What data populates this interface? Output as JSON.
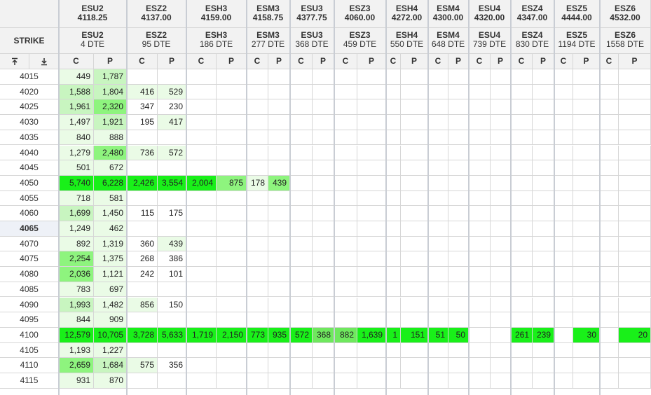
{
  "header": {
    "strike_label": "STRIKE",
    "call_label": "C",
    "put_label": "P",
    "sort_top_icon": "pin-top-icon",
    "sort_bottom_icon": "pin-bottom-icon"
  },
  "expirations": [
    {
      "future": "ESU2",
      "price": "4118.25",
      "dte_future": "ESU2",
      "dte": "4 DTE"
    },
    {
      "future": "ESZ2",
      "price": "4137.00",
      "dte_future": "ESZ2",
      "dte": "95 DTE"
    },
    {
      "future": "ESH3",
      "price": "4159.00",
      "dte_future": "ESH3",
      "dte": "186 DTE"
    },
    {
      "future": "ESM3",
      "price": "4158.75",
      "dte_future": "ESM3",
      "dte": "277 DTE"
    },
    {
      "future": "ESU3",
      "price": "4377.75",
      "dte_future": "ESU3",
      "dte": "368 DTE"
    },
    {
      "future": "ESZ3",
      "price": "4060.00",
      "dte_future": "ESZ3",
      "dte": "459 DTE"
    },
    {
      "future": "ESH4",
      "price": "4272.00",
      "dte_future": "ESH4",
      "dte": "550 DTE"
    },
    {
      "future": "ESM4",
      "price": "4300.00",
      "dte_future": "ESM4",
      "dte": "648 DTE"
    },
    {
      "future": "ESU4",
      "price": "4320.00",
      "dte_future": "ESU4",
      "dte": "739 DTE"
    },
    {
      "future": "ESZ4",
      "price": "4347.00",
      "dte_future": "ESZ4",
      "dte": "830 DTE"
    },
    {
      "future": "ESZ5",
      "price": "4444.00",
      "dte_future": "ESZ5",
      "dte": "1194 DTE"
    },
    {
      "future": "ESZ6",
      "price": "4532.00",
      "dte_future": "ESZ6",
      "dte": "1558 DTE"
    }
  ],
  "selected_strike": "4065",
  "rows": [
    {
      "strike": "4015",
      "cells": [
        [
          "449",
          "1,787"
        ],
        [
          "",
          ""
        ],
        [
          "",
          ""
        ],
        [
          "",
          ""
        ],
        [
          "",
          ""
        ],
        [
          "",
          ""
        ],
        [
          "",
          ""
        ],
        [
          "",
          ""
        ],
        [
          "",
          ""
        ],
        [
          "",
          ""
        ],
        [
          "",
          ""
        ],
        [
          "",
          ""
        ]
      ]
    },
    {
      "strike": "4020",
      "cells": [
        [
          "1,588",
          "1,804"
        ],
        [
          "416",
          "529"
        ],
        [
          "",
          ""
        ],
        [
          "",
          ""
        ],
        [
          "",
          ""
        ],
        [
          "",
          ""
        ],
        [
          "",
          ""
        ],
        [
          "",
          ""
        ],
        [
          "",
          ""
        ],
        [
          "",
          ""
        ],
        [
          "",
          ""
        ],
        [
          "",
          ""
        ]
      ]
    },
    {
      "strike": "4025",
      "cells": [
        [
          "1,961",
          "2,320"
        ],
        [
          "347",
          "230"
        ],
        [
          "",
          ""
        ],
        [
          "",
          ""
        ],
        [
          "",
          ""
        ],
        [
          "",
          ""
        ],
        [
          "",
          ""
        ],
        [
          "",
          ""
        ],
        [
          "",
          ""
        ],
        [
          "",
          ""
        ],
        [
          "",
          ""
        ],
        [
          "",
          ""
        ]
      ]
    },
    {
      "strike": "4030",
      "cells": [
        [
          "1,497",
          "1,921"
        ],
        [
          "195",
          "417"
        ],
        [
          "",
          ""
        ],
        [
          "",
          ""
        ],
        [
          "",
          ""
        ],
        [
          "",
          ""
        ],
        [
          "",
          ""
        ],
        [
          "",
          ""
        ],
        [
          "",
          ""
        ],
        [
          "",
          ""
        ],
        [
          "",
          ""
        ],
        [
          "",
          ""
        ]
      ]
    },
    {
      "strike": "4035",
      "cells": [
        [
          "840",
          "888"
        ],
        [
          "",
          ""
        ],
        [
          "",
          ""
        ],
        [
          "",
          ""
        ],
        [
          "",
          ""
        ],
        [
          "",
          ""
        ],
        [
          "",
          ""
        ],
        [
          "",
          ""
        ],
        [
          "",
          ""
        ],
        [
          "",
          ""
        ],
        [
          "",
          ""
        ],
        [
          "",
          ""
        ]
      ]
    },
    {
      "strike": "4040",
      "cells": [
        [
          "1,279",
          "2,480"
        ],
        [
          "736",
          "572"
        ],
        [
          "",
          ""
        ],
        [
          "",
          ""
        ],
        [
          "",
          ""
        ],
        [
          "",
          ""
        ],
        [
          "",
          ""
        ],
        [
          "",
          ""
        ],
        [
          "",
          ""
        ],
        [
          "",
          ""
        ],
        [
          "",
          ""
        ],
        [
          "",
          ""
        ]
      ]
    },
    {
      "strike": "4045",
      "cells": [
        [
          "501",
          "672"
        ],
        [
          "",
          ""
        ],
        [
          "",
          ""
        ],
        [
          "",
          ""
        ],
        [
          "",
          ""
        ],
        [
          "",
          ""
        ],
        [
          "",
          ""
        ],
        [
          "",
          ""
        ],
        [
          "",
          ""
        ],
        [
          "",
          ""
        ],
        [
          "",
          ""
        ],
        [
          "",
          ""
        ]
      ]
    },
    {
      "strike": "4050",
      "cells": [
        [
          "5,740",
          "6,228"
        ],
        [
          "2,426",
          "3,554"
        ],
        [
          "2,004",
          "875"
        ],
        [
          "178",
          "439"
        ],
        [
          "",
          ""
        ],
        [
          "",
          ""
        ],
        [
          "",
          ""
        ],
        [
          "",
          ""
        ],
        [
          "",
          ""
        ],
        [
          "",
          ""
        ],
        [
          "",
          ""
        ],
        [
          "",
          ""
        ]
      ]
    },
    {
      "strike": "4055",
      "cells": [
        [
          "718",
          "581"
        ],
        [
          "",
          ""
        ],
        [
          "",
          ""
        ],
        [
          "",
          ""
        ],
        [
          "",
          ""
        ],
        [
          "",
          ""
        ],
        [
          "",
          ""
        ],
        [
          "",
          ""
        ],
        [
          "",
          ""
        ],
        [
          "",
          ""
        ],
        [
          "",
          ""
        ],
        [
          "",
          ""
        ]
      ]
    },
    {
      "strike": "4060",
      "cells": [
        [
          "1,699",
          "1,450"
        ],
        [
          "115",
          "175"
        ],
        [
          "",
          ""
        ],
        [
          "",
          ""
        ],
        [
          "",
          ""
        ],
        [
          "",
          ""
        ],
        [
          "",
          ""
        ],
        [
          "",
          ""
        ],
        [
          "",
          ""
        ],
        [
          "",
          ""
        ],
        [
          "",
          ""
        ],
        [
          "",
          ""
        ]
      ]
    },
    {
      "strike": "4065",
      "cells": [
        [
          "1,249",
          "462"
        ],
        [
          "",
          ""
        ],
        [
          "",
          ""
        ],
        [
          "",
          ""
        ],
        [
          "",
          ""
        ],
        [
          "",
          ""
        ],
        [
          "",
          ""
        ],
        [
          "",
          ""
        ],
        [
          "",
          ""
        ],
        [
          "",
          ""
        ],
        [
          "",
          ""
        ],
        [
          "",
          ""
        ]
      ]
    },
    {
      "strike": "4070",
      "cells": [
        [
          "892",
          "1,319"
        ],
        [
          "360",
          "439"
        ],
        [
          "",
          ""
        ],
        [
          "",
          ""
        ],
        [
          "",
          ""
        ],
        [
          "",
          ""
        ],
        [
          "",
          ""
        ],
        [
          "",
          ""
        ],
        [
          "",
          ""
        ],
        [
          "",
          ""
        ],
        [
          "",
          ""
        ],
        [
          "",
          ""
        ]
      ]
    },
    {
      "strike": "4075",
      "cells": [
        [
          "2,254",
          "1,375"
        ],
        [
          "268",
          "386"
        ],
        [
          "",
          ""
        ],
        [
          "",
          ""
        ],
        [
          "",
          ""
        ],
        [
          "",
          ""
        ],
        [
          "",
          ""
        ],
        [
          "",
          ""
        ],
        [
          "",
          ""
        ],
        [
          "",
          ""
        ],
        [
          "",
          ""
        ],
        [
          "",
          ""
        ]
      ]
    },
    {
      "strike": "4080",
      "cells": [
        [
          "2,036",
          "1,121"
        ],
        [
          "242",
          "101"
        ],
        [
          "",
          ""
        ],
        [
          "",
          ""
        ],
        [
          "",
          ""
        ],
        [
          "",
          ""
        ],
        [
          "",
          ""
        ],
        [
          "",
          ""
        ],
        [
          "",
          ""
        ],
        [
          "",
          ""
        ],
        [
          "",
          ""
        ],
        [
          "",
          ""
        ]
      ]
    },
    {
      "strike": "4085",
      "cells": [
        [
          "783",
          "697"
        ],
        [
          "",
          ""
        ],
        [
          "",
          ""
        ],
        [
          "",
          ""
        ],
        [
          "",
          ""
        ],
        [
          "",
          ""
        ],
        [
          "",
          ""
        ],
        [
          "",
          ""
        ],
        [
          "",
          ""
        ],
        [
          "",
          ""
        ],
        [
          "",
          ""
        ],
        [
          "",
          ""
        ]
      ]
    },
    {
      "strike": "4090",
      "cells": [
        [
          "1,993",
          "1,482"
        ],
        [
          "856",
          "150"
        ],
        [
          "",
          ""
        ],
        [
          "",
          ""
        ],
        [
          "",
          ""
        ],
        [
          "",
          ""
        ],
        [
          "",
          ""
        ],
        [
          "",
          ""
        ],
        [
          "",
          ""
        ],
        [
          "",
          ""
        ],
        [
          "",
          ""
        ],
        [
          "",
          ""
        ]
      ]
    },
    {
      "strike": "4095",
      "cells": [
        [
          "844",
          "909"
        ],
        [
          "",
          ""
        ],
        [
          "",
          ""
        ],
        [
          "",
          ""
        ],
        [
          "",
          ""
        ],
        [
          "",
          ""
        ],
        [
          "",
          ""
        ],
        [
          "",
          ""
        ],
        [
          "",
          ""
        ],
        [
          "",
          ""
        ],
        [
          "",
          ""
        ],
        [
          "",
          ""
        ]
      ]
    },
    {
      "strike": "4100",
      "cells": [
        [
          "12,579",
          "10,705"
        ],
        [
          "3,728",
          "5,633"
        ],
        [
          "1,719",
          "2,150"
        ],
        [
          "773",
          "935"
        ],
        [
          "572",
          "368"
        ],
        [
          "882",
          "1,639"
        ],
        [
          "1",
          "151"
        ],
        [
          "51",
          "50"
        ],
        [
          "",
          ""
        ],
        [
          "261",
          "239"
        ],
        [
          "",
          "30"
        ],
        [
          "",
          "20"
        ]
      ]
    },
    {
      "strike": "4105",
      "cells": [
        [
          "1,193",
          "1,227"
        ],
        [
          "",
          ""
        ],
        [
          "",
          ""
        ],
        [
          "",
          ""
        ],
        [
          "",
          ""
        ],
        [
          "",
          ""
        ],
        [
          "",
          ""
        ],
        [
          "",
          ""
        ],
        [
          "",
          ""
        ],
        [
          "",
          ""
        ],
        [
          "",
          ""
        ],
        [
          "",
          ""
        ]
      ]
    },
    {
      "strike": "4110",
      "cells": [
        [
          "2,659",
          "1,684"
        ],
        [
          "575",
          "356"
        ],
        [
          "",
          ""
        ],
        [
          "",
          ""
        ],
        [
          "",
          ""
        ],
        [
          "",
          ""
        ],
        [
          "",
          ""
        ],
        [
          "",
          ""
        ],
        [
          "",
          ""
        ],
        [
          "",
          ""
        ],
        [
          "",
          ""
        ],
        [
          "",
          ""
        ]
      ]
    },
    {
      "strike": "4115",
      "cells": [
        [
          "931",
          "870"
        ],
        [
          "",
          ""
        ],
        [
          "",
          ""
        ],
        [
          "",
          ""
        ],
        [
          "",
          ""
        ],
        [
          "",
          ""
        ],
        [
          "",
          ""
        ],
        [
          "",
          ""
        ],
        [
          "",
          ""
        ],
        [
          "",
          ""
        ],
        [
          "",
          ""
        ],
        [
          "",
          ""
        ]
      ]
    }
  ],
  "colors": {
    "heat_light": "#eafbe6",
    "heat_mid": "#c8f5c0",
    "heat_strong": "#8ef47e",
    "heat_max": "#19f019"
  }
}
